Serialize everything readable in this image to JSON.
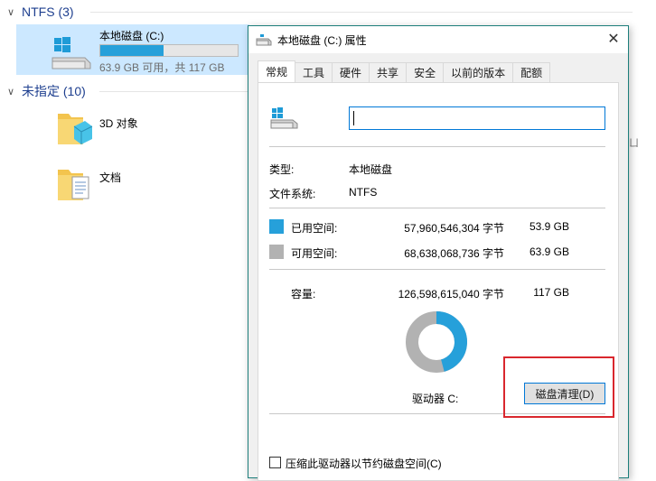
{
  "explorer": {
    "group_ntfs": "NTFS (3)",
    "drive": {
      "name": "本地磁盘 (C:)",
      "free_text": "63.9 GB 可用，共 117 GB",
      "used_fraction": 0.46
    },
    "group_unspecified": "未指定 (10)",
    "items": [
      {
        "label": "3D 对象"
      },
      {
        "label": "文档"
      }
    ],
    "side_fragment": "ㄩ"
  },
  "dialog": {
    "title": "本地磁盘 (C:) 属性",
    "close_glyph": "✕",
    "tabs": [
      {
        "label": "常规",
        "active": true
      },
      {
        "label": "工具"
      },
      {
        "label": "硬件"
      },
      {
        "label": "共享"
      },
      {
        "label": "安全"
      },
      {
        "label": "以前的版本"
      },
      {
        "label": "配额"
      }
    ],
    "name_value": "",
    "type_label": "类型:",
    "type_value": "本地磁盘",
    "fs_label": "文件系统:",
    "fs_value": "NTFS",
    "used": {
      "label": "已用空间:",
      "bytes": "57,960,546,304 字节",
      "size": "53.9 GB",
      "color": "#26a0da"
    },
    "free": {
      "label": "可用空间:",
      "bytes": "68,638,068,736 字节",
      "size": "63.9 GB",
      "color": "#b2b2b2"
    },
    "capacity": {
      "label": "容量:",
      "bytes": "126,598,615,040 字节",
      "size": "117 GB"
    },
    "drive_label": "驱动器 C:",
    "cleanup_button": "磁盘清理(D)",
    "compress_label": "压缩此驱动器以节约磁盘空间(C)"
  }
}
